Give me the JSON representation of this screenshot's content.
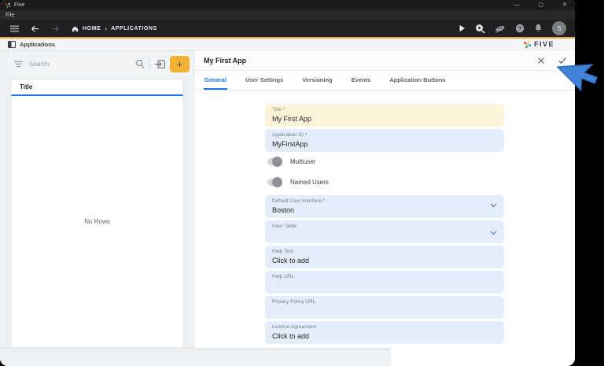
{
  "window": {
    "app_title": "Five",
    "menu_items": {
      "file": "File"
    },
    "controls": {
      "minimize": "—",
      "maximize": "▢",
      "close": "✕"
    }
  },
  "navbar": {
    "breadcrumb": {
      "home_label": "HOME",
      "separator": "›",
      "current": "APPLICATIONS"
    },
    "avatar_initial": "S"
  },
  "appbar": {
    "title": "Applications",
    "brand_wordmark": "FIVE"
  },
  "list_panel": {
    "search_placeholder": "Search",
    "add_button": "+",
    "column_header": "Title",
    "empty_text": "No Rows"
  },
  "detail_panel": {
    "title": "My First App",
    "tabs": [
      {
        "label": "General",
        "active": true
      },
      {
        "label": "User Settings",
        "active": false
      },
      {
        "label": "Versioning",
        "active": false
      },
      {
        "label": "Events",
        "active": false
      },
      {
        "label": "Application Buttons",
        "active": false
      }
    ],
    "fields": [
      {
        "label": "Title *",
        "value": "My First App",
        "style": "highlight"
      },
      {
        "label": "Application ID *",
        "value": "MyFirstApp",
        "style": "normal"
      },
      {
        "label": "Default User Interface *",
        "value": "Boston",
        "style": "select"
      },
      {
        "label": "User Table",
        "value": "",
        "style": "select"
      },
      {
        "label": "Help Text",
        "value": "Click to add",
        "style": "normal"
      },
      {
        "label": "Help URL",
        "value": "",
        "style": "normal"
      },
      {
        "label": "Privacy Policy URL",
        "value": "",
        "style": "normal"
      },
      {
        "label": "License Agreement",
        "value": "Click to add",
        "style": "normal"
      }
    ],
    "toggles": [
      {
        "label": "Multiuser",
        "on": false
      },
      {
        "label": "Named Users",
        "on": false
      }
    ]
  },
  "colors": {
    "accent_bar": "#eda63a",
    "active_tab": "#1a73e8",
    "field_highlight_bg": "#fdf3da",
    "field_bg": "#e4eefa",
    "add_button_bg": "#f2b236",
    "cursor": "#4183d7"
  }
}
